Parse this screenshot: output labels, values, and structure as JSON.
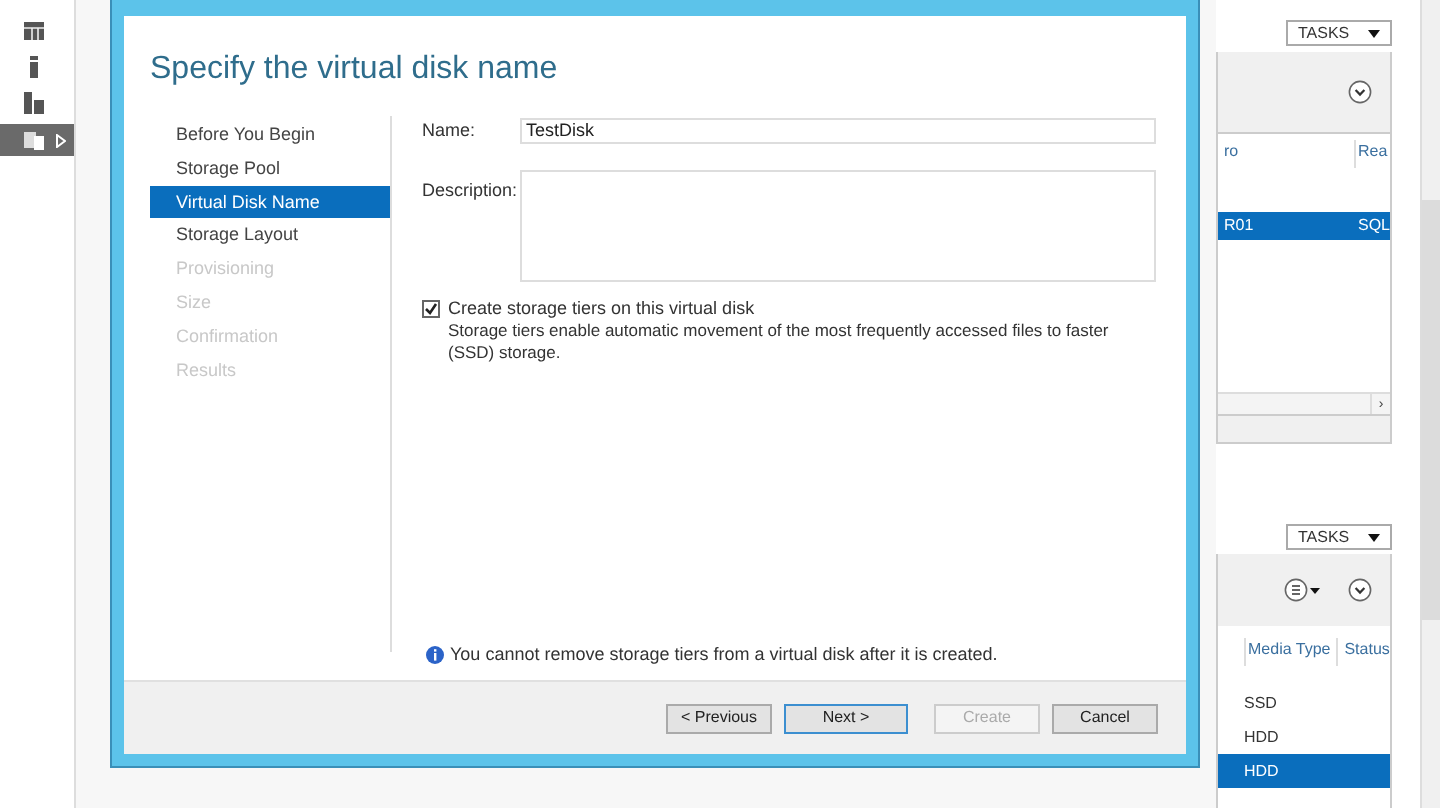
{
  "sidebar": {
    "items": [
      {
        "selected": false
      },
      {
        "selected": false
      },
      {
        "selected": false
      },
      {
        "selected": true
      }
    ]
  },
  "wizard": {
    "heading": "Specify the virtual disk name",
    "steps": [
      {
        "label": "Before You Begin",
        "selected": false,
        "disabled": false
      },
      {
        "label": "Storage Pool",
        "selected": false,
        "disabled": false
      },
      {
        "label": "Virtual Disk Name",
        "selected": true,
        "disabled": false
      },
      {
        "label": "Storage Layout",
        "selected": false,
        "disabled": false
      },
      {
        "label": "Provisioning",
        "selected": false,
        "disabled": true
      },
      {
        "label": "Size",
        "selected": false,
        "disabled": true
      },
      {
        "label": "Confirmation",
        "selected": false,
        "disabled": true
      },
      {
        "label": "Results",
        "selected": false,
        "disabled": true
      }
    ],
    "name_label": "Name:",
    "name_value": "TestDisk",
    "description_label": "Description:",
    "tiers": {
      "checked": true,
      "label": "Create storage tiers on this virtual disk",
      "help": "Storage tiers enable automatic movement of the most frequently accessed files to faster (SSD) storage."
    },
    "info": "You cannot remove storage tiers from a virtual disk after it is created.",
    "buttons": [
      {
        "label": "< Previous",
        "disabled": false,
        "default": false
      },
      {
        "label": "Next >",
        "disabled": false,
        "default": true
      },
      {
        "label": "Create",
        "disabled": true,
        "default": false
      },
      {
        "label": "Cancel",
        "disabled": false,
        "default": false
      }
    ]
  },
  "upper_panel": {
    "tasks": "TASKS",
    "scroll_right": "›",
    "columns": [
      "ro",
      "Rea"
    ],
    "rows": [
      {
        "cells": [
          "R01",
          "SQL"
        ],
        "selected": true
      }
    ]
  },
  "lower_panel": {
    "tasks": "TASKS",
    "columns": [
      "Media Type",
      "Status"
    ],
    "rows": [
      {
        "cells": [
          "SSD"
        ],
        "selected": false
      },
      {
        "cells": [
          "HDD"
        ],
        "selected": false
      },
      {
        "cells": [
          "HDD"
        ],
        "selected": true
      }
    ]
  }
}
